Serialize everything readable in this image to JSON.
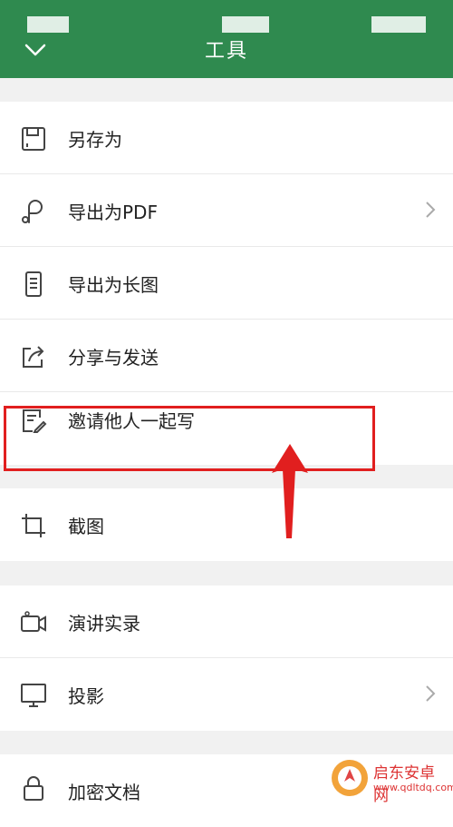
{
  "header": {
    "title": "工具",
    "back_icon": "chevron-down-icon",
    "bg": "#2f8a4f"
  },
  "sections": [
    {
      "items": [
        {
          "label": "另存为",
          "icon": "save-icon"
        },
        {
          "label": "导出为PDF",
          "icon": "pdf-export-icon",
          "has_chevron": true
        },
        {
          "label": "导出为长图",
          "icon": "long-image-icon"
        },
        {
          "label": "分享与发送",
          "icon": "share-icon"
        },
        {
          "label": "邀请他人一起写",
          "icon": "invite-edit-icon"
        }
      ]
    },
    {
      "items": [
        {
          "label": "截图",
          "icon": "crop-icon"
        }
      ]
    },
    {
      "items": [
        {
          "label": "演讲实录",
          "icon": "video-record-icon"
        },
        {
          "label": "投影",
          "icon": "monitor-icon",
          "has_chevron": true
        }
      ]
    },
    {
      "items": [
        {
          "label": "加密文档",
          "icon": "lock-icon"
        }
      ]
    }
  ],
  "annotation": {
    "color": "#e11f1f"
  },
  "watermark": {
    "name": "启东安卓网",
    "url": "www.qdltdq.com"
  }
}
